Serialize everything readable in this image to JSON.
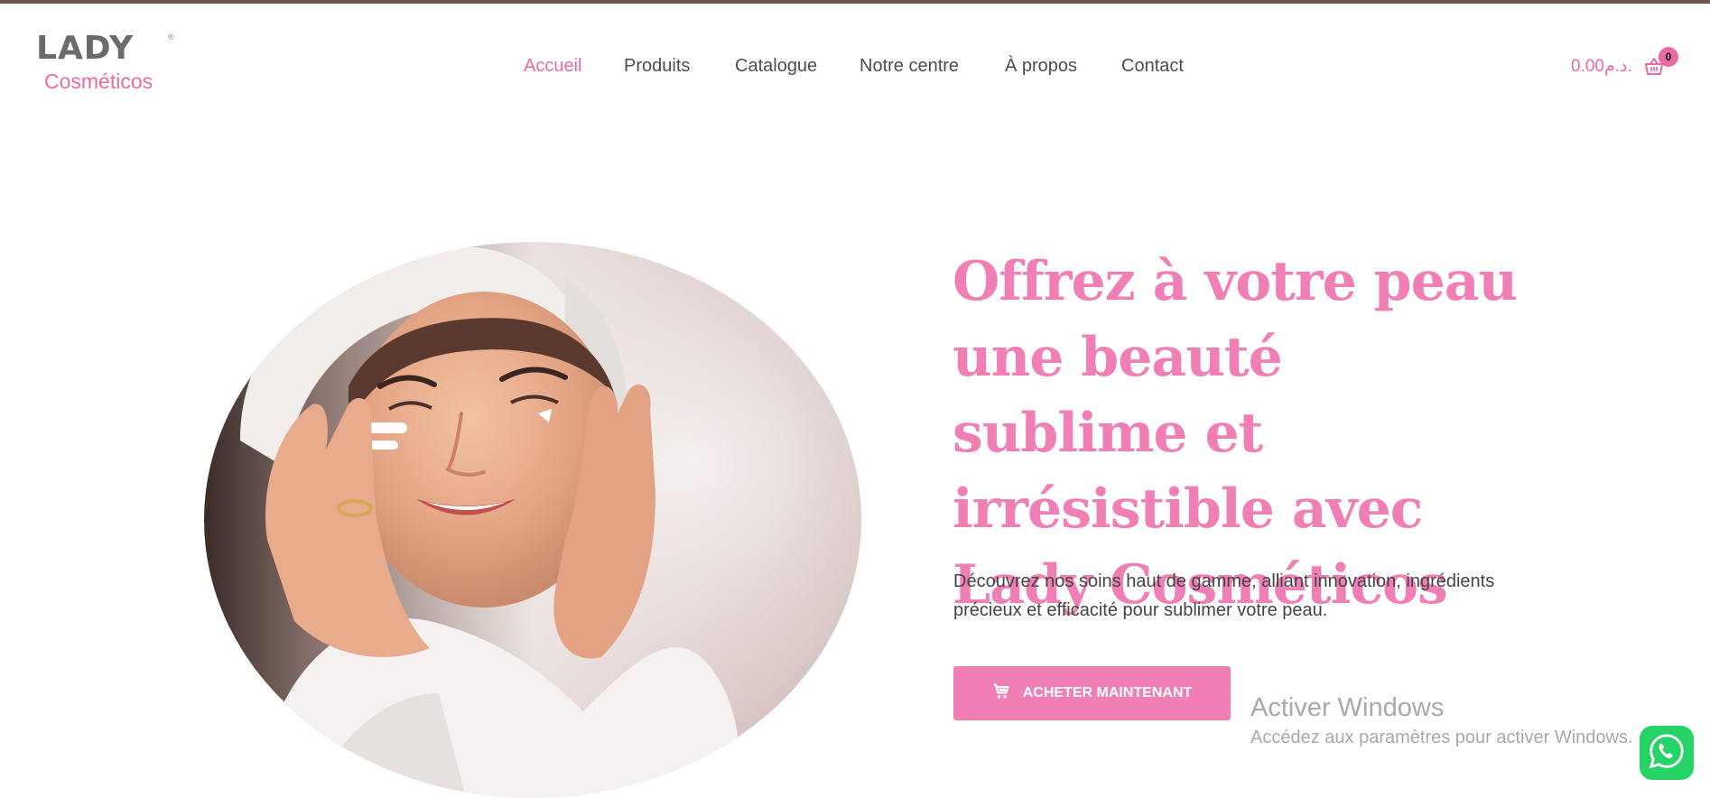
{
  "brand": {
    "logo_main": "LADY",
    "logo_sub": "Cosméticos",
    "registered_mark": "®"
  },
  "nav": {
    "items": [
      "Accueil",
      "Produits",
      "Catalogue",
      "Notre centre",
      "À propos",
      "Contact"
    ],
    "active": "Accueil"
  },
  "cart": {
    "total": "0.00د.م.",
    "count": "0",
    "icon": "basket-icon"
  },
  "hero": {
    "image": "woman-applying-face-cream-photo",
    "title": "Offrez à votre peau une beauté sublime et irrésistible avec Lady Cosméticos",
    "description": "Découvrez nos soins haut de gamme, alliant innovation, ingrédients précieux et efficacité pour sublimer votre peau.",
    "cta_label": "Acheter maintenant",
    "cta_icon": "cart-icon"
  },
  "windows_watermark": {
    "title": "Activer Windows",
    "subtitle": "Accédez aux paramètres pour activer Windows."
  },
  "whatsapp": {
    "icon": "whatsapp-icon"
  },
  "colors": {
    "accent": "#ef7fb4",
    "accent_dark": "#ea6aa5",
    "text": "#444444",
    "topbar": "#6b5350",
    "whatsapp": "#25d366"
  }
}
